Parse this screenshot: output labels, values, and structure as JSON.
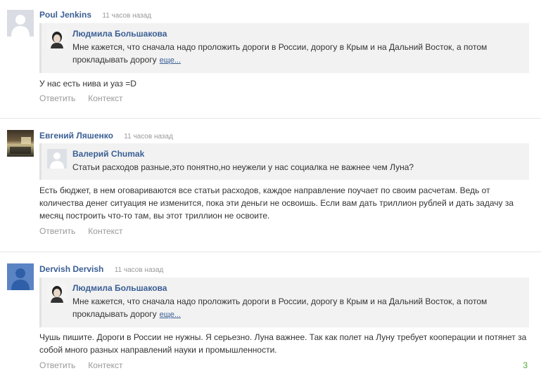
{
  "comments": [
    {
      "author": "Poul Jenkins",
      "time": "11 часов назад",
      "avatar_icon": "default-user-avatar-gray",
      "quote": {
        "author": "Людмила Большакова",
        "text": "Мне кажется, что сначала надо проложить дороги в России, дорогу в Крым и на Дальний Восток, а потом прокладывать дорогу",
        "more": "еще..."
      },
      "body": "У нас есть нива и уаз =D",
      "reply": "Ответить",
      "context": "Контекст"
    },
    {
      "author": "Евгений Ляшенко",
      "time": "11 часов назад",
      "avatar_icon": "photo-avatar",
      "quote": {
        "author": "Валерий Chumak",
        "text": "Статьи расходов разные,это понятно,но неужели у нас социалка не важнее чем Луна?"
      },
      "body": "Есть бюджет, в нем оговариваются все статьи расходов, каждое направление поучает по своим расчетам. Ведь от количества денег ситуация не изменится, пока эти деньги не освоишь. Если вам дать триллион рублей и дать задачу за месяц построить что-то там, вы этот триллион не освоите.",
      "reply": "Ответить",
      "context": "Контекст"
    },
    {
      "author": "Dervish Dervish",
      "time": "11 часов назад",
      "avatar_icon": "default-user-avatar-blue",
      "quote": {
        "author": "Людмила Большакова",
        "text": "Мне кажется, что сначала надо проложить дороги в России, дорогу в Крым и на Дальний Восток, а потом прокладывать дорогу",
        "more": "еще..."
      },
      "body": "Чушь пишите. Дороги в России не нужны. Я серьезно. Луна важнее. Так как полет на Луну требует кооперации и потянет за собой много разных направлений науки и промышленности.",
      "reply": "Ответить",
      "context": "Контекст"
    }
  ],
  "counter": "3",
  "colors": {
    "link": "#3a5f94",
    "muted": "#999999",
    "quote_bg": "#f2f2f2",
    "counter": "#55a838"
  }
}
